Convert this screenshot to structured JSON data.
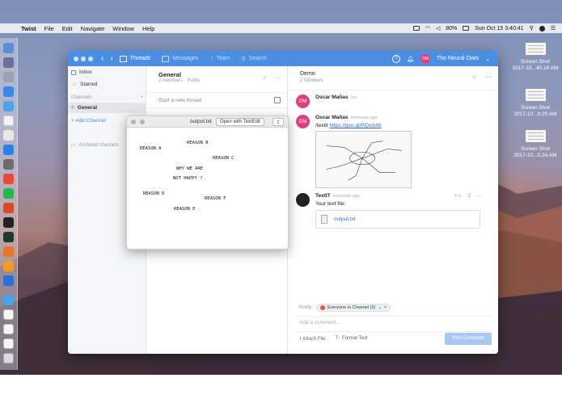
{
  "menubar": {
    "app_name": "Twist",
    "menus": [
      "File",
      "Edit",
      "Navigate",
      "Window",
      "Help"
    ],
    "battery": "80%",
    "clock": "Sun Oct 15  3:40:41"
  },
  "desktop_files": [
    {
      "label_line1": "Screen Shot",
      "label_line2": "2017-10...40.18 AM"
    },
    {
      "label_line1": "Screen Shot",
      "label_line2": "2017-10...0.20 AM"
    },
    {
      "label_line1": "Screen Shot",
      "label_line2": "2017-10...0.24 AM"
    }
  ],
  "toolbar": {
    "threads": "Threads",
    "messages": "Messages",
    "team": "Team",
    "search": "Search",
    "workspace_initials": "OM",
    "workspace_name": "The Neural Owls"
  },
  "sidebar": {
    "inbox": "Inbox",
    "starred": "Starred",
    "channels_header": "Channels",
    "channel_general": "General",
    "add_channel": "+ Add Channel",
    "archived": "Archived channels"
  },
  "thread_list": {
    "title": "General",
    "subtitle": "2 members · Public",
    "start_new": "Start a new thread"
  },
  "thread": {
    "title": "Demo",
    "subtitle": "2 followers",
    "messages": [
      {
        "initials": "OM",
        "author": "Oscar Mañas",
        "time": "1m",
        "text": ""
      },
      {
        "initials": "OM",
        "author": "Oscar Mañas",
        "time": "moments ago",
        "text_prefix": "/textit ",
        "link": "https://goo.gl/PQoXAb"
      },
      {
        "author": "TextIT",
        "time": "moments ago",
        "text": "Your text file:",
        "file": "output.txt",
        "reactions": "+☺",
        "participants": "2"
      }
    ],
    "composer": {
      "notify_label": "Notify:",
      "notify_chip": "Everyone in Channel (2)",
      "placeholder": "Add a comment...",
      "attach": "Attach File",
      "format": "Format Text",
      "post": "Post Comment"
    }
  },
  "quicklook": {
    "title": "output.txt",
    "open_button": "Open with TextEdit",
    "lines": [
      {
        "text": "REASON B",
        "col": 13
      },
      {
        "text": "REASON A",
        "col": 0
      },
      {
        "text": "REASON C",
        "col": 16
      },
      {
        "text": "WHY WE ARE",
        "col": 8
      },
      {
        "text": "NOT HAPPY ?",
        "col": 7
      },
      {
        "text": "REASON D",
        "col": 0
      },
      {
        "text": "REASON F",
        "col": 14
      },
      {
        "text": "REASON E",
        "col": 7
      }
    ]
  }
}
